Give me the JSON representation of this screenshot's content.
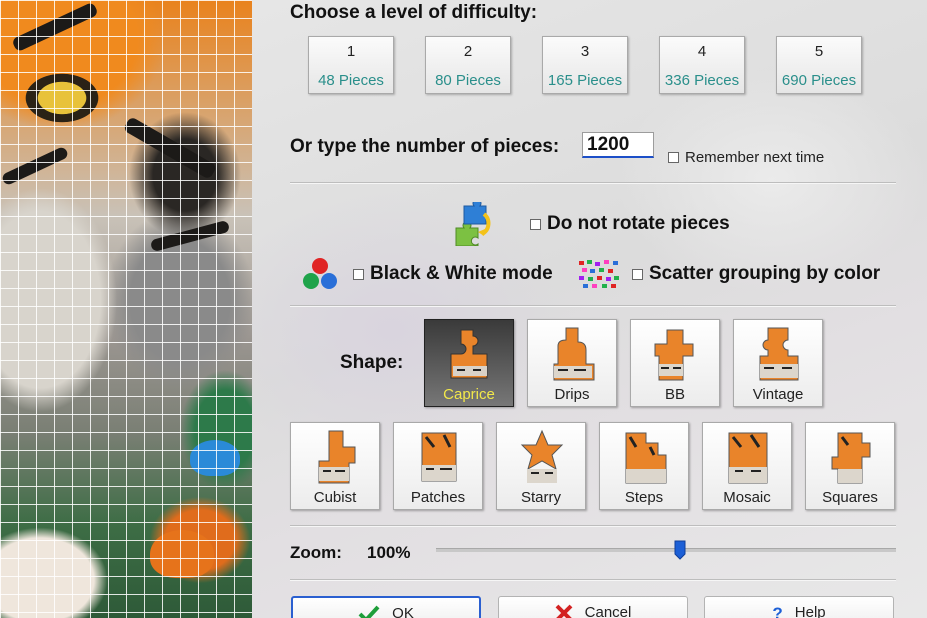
{
  "difficulty": {
    "title": "Choose a level of difficulty:",
    "levels": [
      {
        "number": "1",
        "pieces": "48 Pieces"
      },
      {
        "number": "2",
        "pieces": "80 Pieces"
      },
      {
        "number": "3",
        "pieces": "165 Pieces"
      },
      {
        "number": "4",
        "pieces": "336 Pieces"
      },
      {
        "number": "5",
        "pieces": "690 Pieces"
      }
    ]
  },
  "custom_count": {
    "label": "Or type the number of pieces:",
    "value": "1200",
    "remember_label": "Remember next time",
    "remember_checked": false
  },
  "options": {
    "no_rotate_label": "Do not rotate pieces",
    "no_rotate_checked": false,
    "bw_label": "Black & White mode",
    "bw_checked": false,
    "scatter_label": "Scatter grouping by color",
    "scatter_checked": false
  },
  "shape": {
    "label": "Shape:",
    "selected": "Caprice",
    "row1": [
      "Caprice",
      "Drips",
      "BB",
      "Vintage"
    ],
    "row2": [
      "Cubist",
      "Patches",
      "Starry",
      "Steps",
      "Mosaic",
      "Squares"
    ]
  },
  "zoom": {
    "label": "Zoom:",
    "value": "100%",
    "level": 0.53
  },
  "footer": {
    "ok_label": "OK",
    "cancel_label": "Cancel",
    "help_label": "Help"
  },
  "colors": {
    "accent": "#2a5fd0",
    "pieces_text": "#2a8f8b",
    "selected_caption": "#f2e84a"
  }
}
